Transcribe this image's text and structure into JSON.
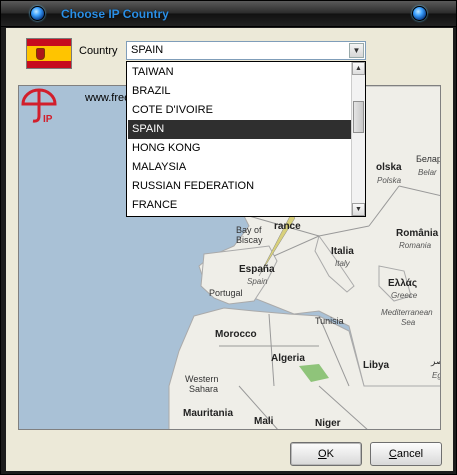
{
  "window": {
    "title": "Choose IP Country"
  },
  "country": {
    "label": "Country",
    "selected": "SPAIN",
    "options": [
      "TAIWAN",
      "BRAZIL",
      "COTE D'IVOIRE",
      "SPAIN",
      "HONG KONG",
      "MALAYSIA",
      "RUSSIAN FEDERATION",
      "FRANCE"
    ],
    "selected_index": 3
  },
  "map": {
    "url_prefix": "www.free",
    "labels": {
      "polska": "olska",
      "polska_it": "Polska",
      "belarus": "Белар",
      "belarus_it": "Belar",
      "france": "rance",
      "bay": "Bay of",
      "biscay": "Biscay",
      "italia": "Italia",
      "italy": "Italy",
      "romania": "România",
      "romania_it": "Romania",
      "espana": "España",
      "spain": "Spain",
      "portugal": "Portugal",
      "ellas": "Ελλάς",
      "greece": "Greece",
      "tunisia": "Tunisia",
      "med1": "Mediterranean",
      "med2": "Sea",
      "morocco": "Morocco",
      "algeria": "Algeria",
      "libya": "Libya",
      "egypt_ar": "مصر",
      "egypt": "Eg",
      "ws1": "Western",
      "ws2": "Sahara",
      "mauritania": "Mauritania",
      "mali": "Mali",
      "niger": "Niger"
    }
  },
  "buttons": {
    "ok_label": "K",
    "ok_mnemonic": "O",
    "cancel_label": "ancel",
    "cancel_mnemonic": "C"
  },
  "colors": {
    "title_text": "#2b8fe6",
    "selected_item_bg": "#2f2f2f",
    "map_water": "#a9c1d6",
    "map_land": "#efeee8"
  }
}
